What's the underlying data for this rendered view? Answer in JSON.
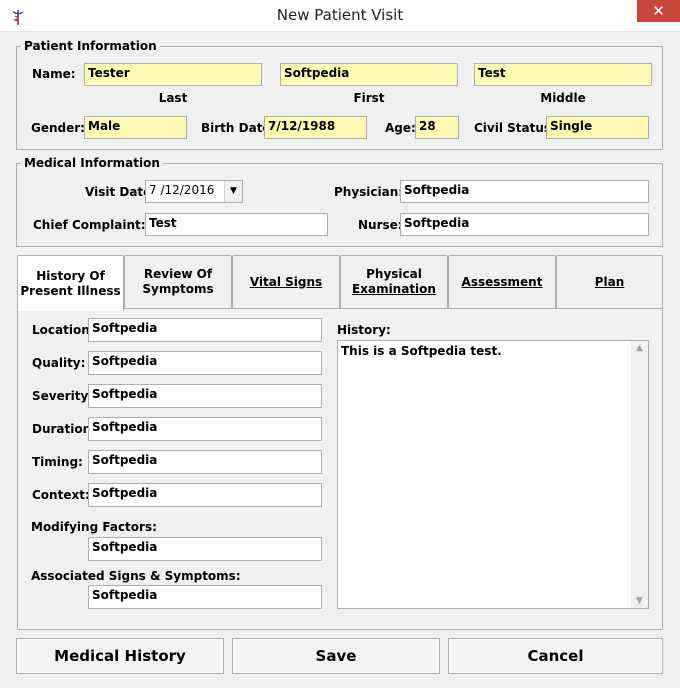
{
  "window": {
    "title": "New Patient Visit",
    "close_glyph": "✕"
  },
  "patient": {
    "legend": "Patient Information",
    "name_label": "Name:",
    "last": "Tester",
    "first": "Softpedia",
    "middle": "Test",
    "last_caption": "Last",
    "first_caption": "First",
    "middle_caption": "Middle",
    "gender_label": "Gender:",
    "gender": "Male",
    "birth_label": "Birth Date:",
    "birth": "7/12/1988",
    "age_label": "Age:",
    "age": "28",
    "civil_label": "Civil Status:",
    "civil": "Single"
  },
  "medical": {
    "legend": "Medical Information",
    "visit_label": "Visit Date:",
    "visit": "7 /12/2016",
    "physician_label": "Physician:",
    "physician": "Softpedia",
    "complaint_label": "Chief Complaint:",
    "complaint": "Test",
    "nurse_label": "Nurse:",
    "nurse": "Softpedia"
  },
  "tabs": [
    {
      "l1": "History Of",
      "l2": "Present Illness"
    },
    {
      "l1": "Review Of",
      "l2": "Symptoms"
    },
    {
      "l1": "Vital Signs",
      "l2": ""
    },
    {
      "l1": "Physical",
      "l2": "Examination"
    },
    {
      "l1": "Assessment",
      "l2": ""
    },
    {
      "l1": "Plan",
      "l2": ""
    }
  ],
  "hpi": {
    "location_label": "Location:",
    "location": "Softpedia",
    "quality_label": "Quality:",
    "quality": "Softpedia",
    "severity_label": "Severity:",
    "severity": "Softpedia",
    "duration_label": "Duration:",
    "duration": "Softpedia",
    "timing_label": "Timing:",
    "timing": "Softpedia",
    "context_label": "Context:",
    "context": "Softpedia",
    "modifying_label": "Modifying Factors:",
    "modifying": "Softpedia",
    "associated_label": "Associated Signs & Symptoms:",
    "associated": "Softpedia",
    "history_label": "History:",
    "history": "This is a Softpedia test."
  },
  "buttons": {
    "medical_history": "Medical History",
    "save": "Save",
    "cancel": "Cancel"
  },
  "colors": {
    "required_field": "#fffbb5",
    "close_button": "#c7453a"
  }
}
